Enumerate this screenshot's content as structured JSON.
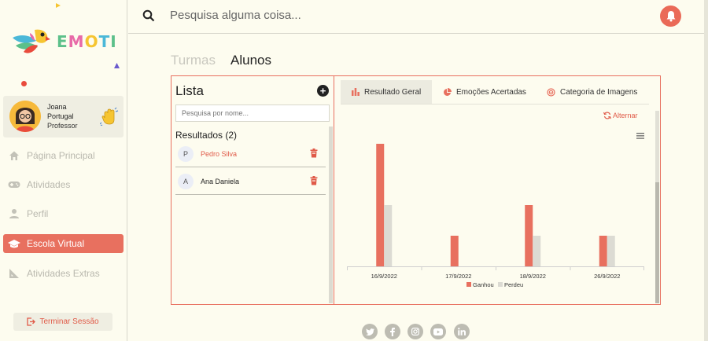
{
  "app": {
    "brand": "EMOTI",
    "search_placeholder": "Pesquisa alguma coisa...",
    "colors": {
      "accent": "#e8705f",
      "accent_dark": "#e05a48",
      "background": "#fdfcef"
    }
  },
  "user": {
    "first_name": "Joana",
    "last_name": "Portugal",
    "role": "Professor"
  },
  "sidebar": {
    "items": [
      {
        "label": "Página Principal",
        "icon": "home-icon"
      },
      {
        "label": "Atividades",
        "icon": "gamepad-icon"
      },
      {
        "label": "Perfil",
        "icon": "person-icon"
      },
      {
        "label": "Escola Virtual",
        "icon": "graduation-cap-icon",
        "active": true
      },
      {
        "label": "Atividades Extras",
        "icon": "ruler-triangle-icon"
      }
    ],
    "logout_label": "Terminar Sessão"
  },
  "page": {
    "tabs": [
      "Turmas",
      "Alunos"
    ],
    "active_tab": "Alunos"
  },
  "list": {
    "title": "Lista",
    "search_placeholder": "Pesquisa por nome...",
    "results_label": "Resultados (2)",
    "results": [
      {
        "initial": "P",
        "name": "Pedro Silva",
        "selected": true
      },
      {
        "initial": "A",
        "name": "Ana Daniela",
        "selected": false
      }
    ]
  },
  "chart_panel": {
    "tabs": [
      {
        "label": "Resultado Geral",
        "icon": "bar-chart-icon",
        "active": true
      },
      {
        "label": "Emoções Acertadas",
        "icon": "pie-chart-icon",
        "active": false
      },
      {
        "label": "Categoria de Imagens",
        "icon": "radar-icon",
        "active": false
      }
    ],
    "toggle_label": "Alternar"
  },
  "chart_data": {
    "type": "bar",
    "categories": [
      "16/9/2022",
      "17/9/2022",
      "18/9/2022",
      "26/9/2022"
    ],
    "series": [
      {
        "name": "Ganhou",
        "color": "#e8705f",
        "values": [
          8,
          2,
          4,
          2
        ]
      },
      {
        "name": "Perdeu",
        "color": "#dcdbd3",
        "values": [
          4,
          0,
          2,
          2
        ]
      }
    ],
    "ylim": [
      0,
      8
    ],
    "grid": false,
    "legend": "bottom"
  },
  "footer": {
    "social": [
      "twitter-icon",
      "facebook-icon",
      "instagram-icon",
      "youtube-icon",
      "linkedin-icon"
    ]
  }
}
